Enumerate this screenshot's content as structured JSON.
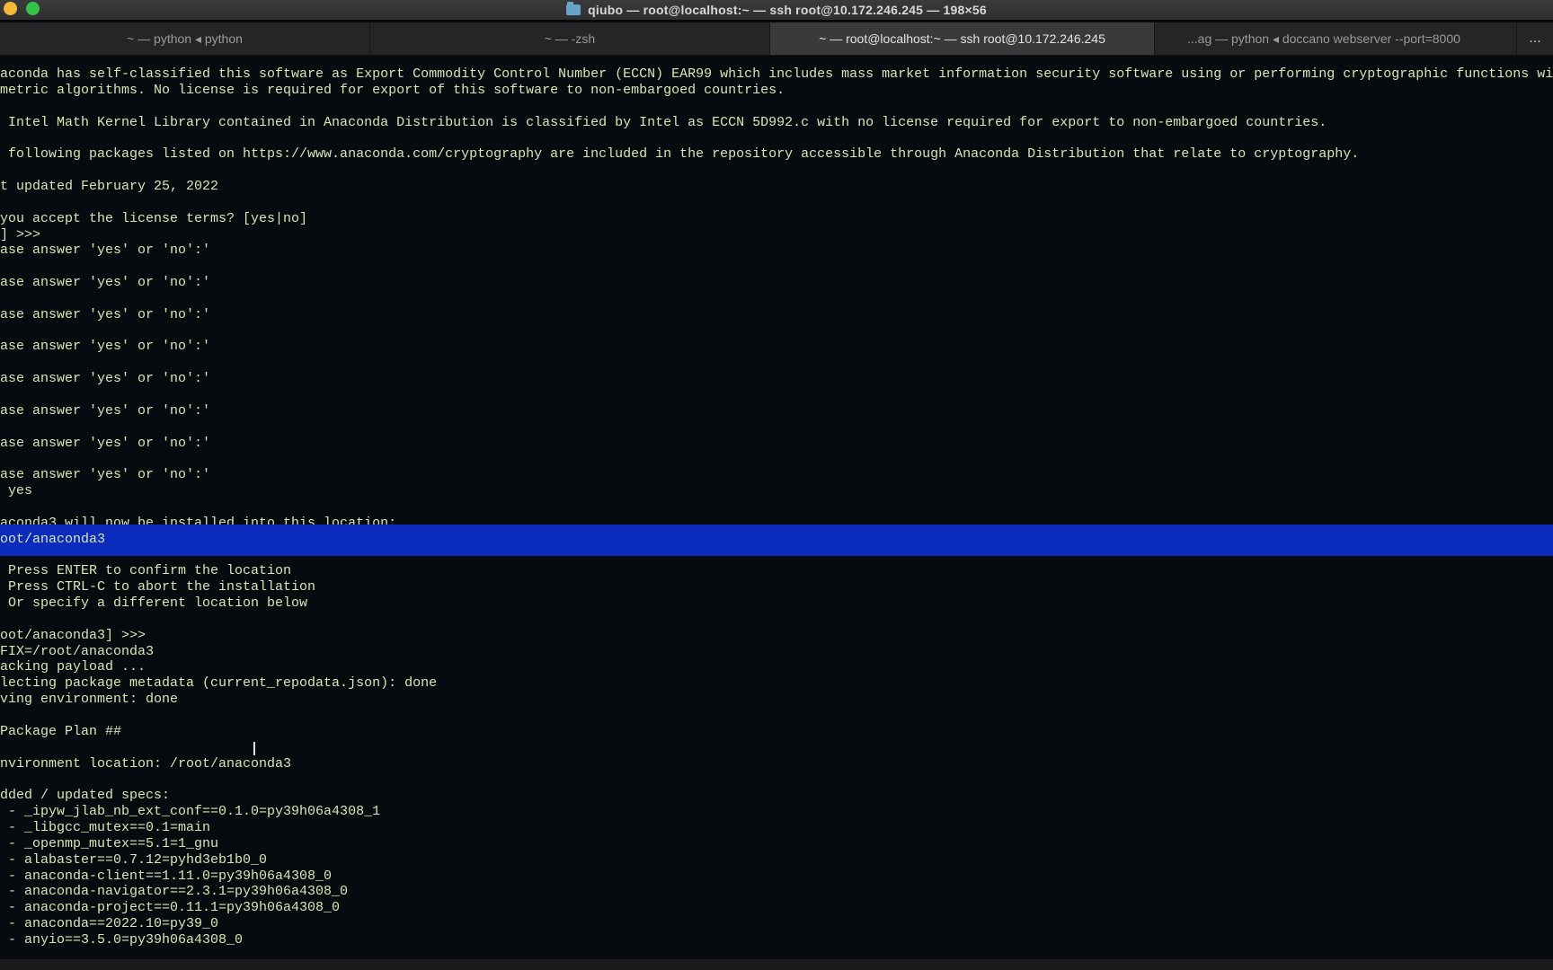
{
  "window": {
    "title": "qiubo — root@localhost:~ — ssh root@10.172.246.245 — 198×56"
  },
  "tabs": [
    {
      "label": "~ — python ◂ python"
    },
    {
      "label": "~ — -zsh"
    },
    {
      "label": "~ — root@localhost:~ — ssh root@10.172.246.245"
    },
    {
      "label": "...ag — python ◂ doccano webserver --port=8000"
    }
  ],
  "tab_overflow": "...",
  "terminal": {
    "selected_line_index": 21,
    "lines": [
      "aconda has self-classified this software as Export Commodity Control Number (ECCN) EAR99 which includes mass market information security software using or performing cryptographic functions with",
      "metric algorithms. No license is required for export of this software to non-embargoed countries.",
      "",
      " Intel Math Kernel Library contained in Anaconda Distribution is classified by Intel as ECCN 5D992.c with no license required for export to non-embargoed countries.",
      "",
      " following packages listed on https://www.anaconda.com/cryptography are included in the repository accessible through Anaconda Distribution that relate to cryptography.",
      "",
      "t updated February 25, 2022",
      "",
      "you accept the license terms? [yes|no]",
      "] >>>",
      "ase answer 'yes' or 'no':'",
      "",
      "ase answer 'yes' or 'no':'",
      "",
      "ase answer 'yes' or 'no':'",
      "",
      "ase answer 'yes' or 'no':'",
      "",
      "ase answer 'yes' or 'no':'",
      "",
      "ase answer 'yes' or 'no':'",
      "",
      "ase answer 'yes' or 'no':'",
      "",
      "ase answer 'yes' or 'no':'",
      " yes",
      "",
      "aconda3 will now be installed into this location:",
      "oot/anaconda3",
      "",
      " Press ENTER to confirm the location",
      " Press CTRL-C to abort the installation",
      " Or specify a different location below",
      "",
      "oot/anaconda3] >>>",
      "FIX=/root/anaconda3",
      "acking payload ...",
      "lecting package metadata (current_repodata.json): done",
      "ving environment: done",
      "",
      "Package Plan ##",
      "",
      "nvironment location: /root/anaconda3",
      "",
      "dded / updated specs:",
      " - _ipyw_jlab_nb_ext_conf==0.1.0=py39h06a4308_1",
      " - _libgcc_mutex==0.1=main",
      " - _openmp_mutex==5.1=1_gnu",
      " - alabaster==0.7.12=pyhd3eb1b0_0",
      " - anaconda-client==1.11.0=py39h06a4308_0",
      " - anaconda-navigator==2.3.1=py39h06a4308_0",
      " - anaconda-project==0.11.1=py39h06a4308_0",
      " - anaconda==2022.10=py39_0",
      " - anyio==3.5.0=py39h06a4308_0"
    ]
  },
  "colors": {
    "terminal_text": "#d6e6b6",
    "terminal_bg": "#070a0e",
    "selection": "#0b2bbd",
    "active_tab": "#3a3a3c"
  }
}
